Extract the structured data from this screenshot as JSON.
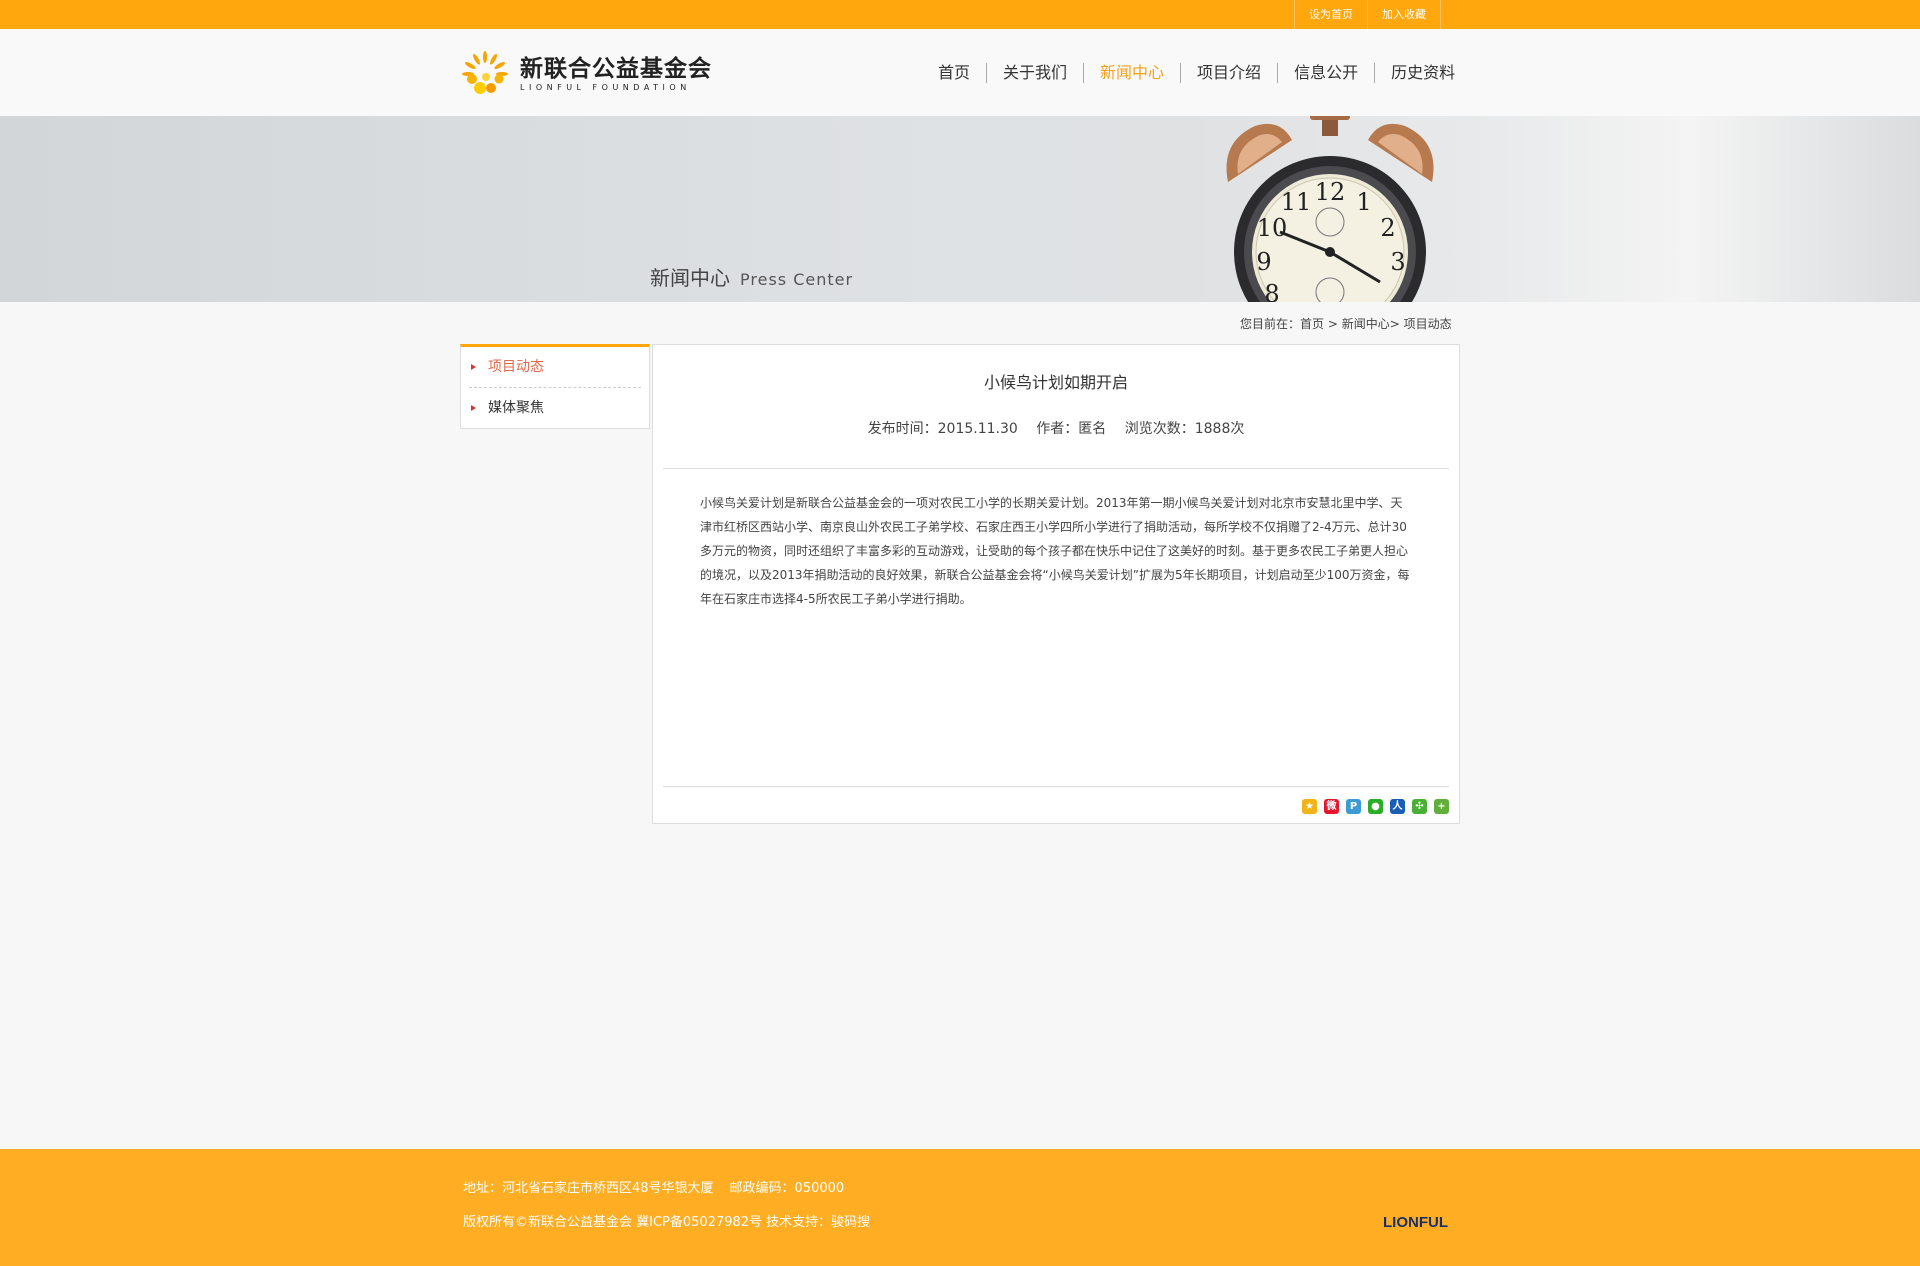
{
  "topbar": {
    "links": [
      "设为首页",
      "加入收藏"
    ],
    "color": "#ffa70d"
  },
  "header": {
    "logo_cn": "新联合公益基金会",
    "logo_en": "LIONFUL FOUNDATION",
    "nav": [
      {
        "label": "首页",
        "active": false
      },
      {
        "label": "关于我们",
        "active": false
      },
      {
        "label": "新闻中心",
        "active": true
      },
      {
        "label": "项目介绍",
        "active": false
      },
      {
        "label": "信息公开",
        "active": false
      },
      {
        "label": "历史资料",
        "active": false
      }
    ]
  },
  "banner": {
    "title_cn": "新闻中心",
    "title_en": "Press Center"
  },
  "breadcrumb": {
    "prefix": "您目前在：",
    "home": "首页",
    "sep1": " > ",
    "section": "新闻中心",
    "sep2": "> ",
    "current": "项目动态"
  },
  "sidebar": {
    "items": [
      {
        "label": "项目动态",
        "active": true
      },
      {
        "label": "媒体聚焦",
        "active": false
      }
    ]
  },
  "article": {
    "title": "小候鸟计划如期开启",
    "publish_label": "发布时间：2015.11.30",
    "author_label": "作者：匿名",
    "views_label": "浏览次数：1888次",
    "body": "小候鸟关爱计划是新联合公益基金会的一项对农民工小学的长期关爱计划。2013年第一期小候鸟关爱计划对北京市安慧北里中学、天津市红桥区西站小学、南京良山外农民工子弟学校、石家庄西王小学四所小学进行了捐助活动，每所学校不仅捐赠了2-4万元、总计30多万元的物资，同时还组织了丰富多彩的互动游戏，让受助的每个孩子都在快乐中记住了这美好的时刻。基于更多农民工子弟更人担心的境况，以及2013年捐助活动的良好效果，新联合公益基金会将“小候鸟关爱计划”扩展为5年长期项目，计划启动至少100万资金，每年在石家庄市选择4-5所农民工子弟小学进行捐助。",
    "share_icons": [
      {
        "name": "qzone-icon",
        "color": "#f2b318"
      },
      {
        "name": "weibo-icon",
        "color": "#e6162d"
      },
      {
        "name": "tencent-weibo-icon",
        "color": "#3c9ad5"
      },
      {
        "name": "wechat-icon",
        "color": "#2aae27"
      },
      {
        "name": "renren-icon",
        "color": "#1a5fb4"
      },
      {
        "name": "kaixin-icon",
        "color": "#4ab035"
      },
      {
        "name": "more-share-icon",
        "color": "#62ae3a"
      }
    ]
  },
  "footer": {
    "address": "地址：河北省石家庄市桥西区48号华银大厦",
    "postcode": "邮政编码：050000",
    "copyright": "版权所有©新联合公益基金会 冀ICP备05027982号 技术支持：骏码搜",
    "brand": "LIONFUL"
  }
}
